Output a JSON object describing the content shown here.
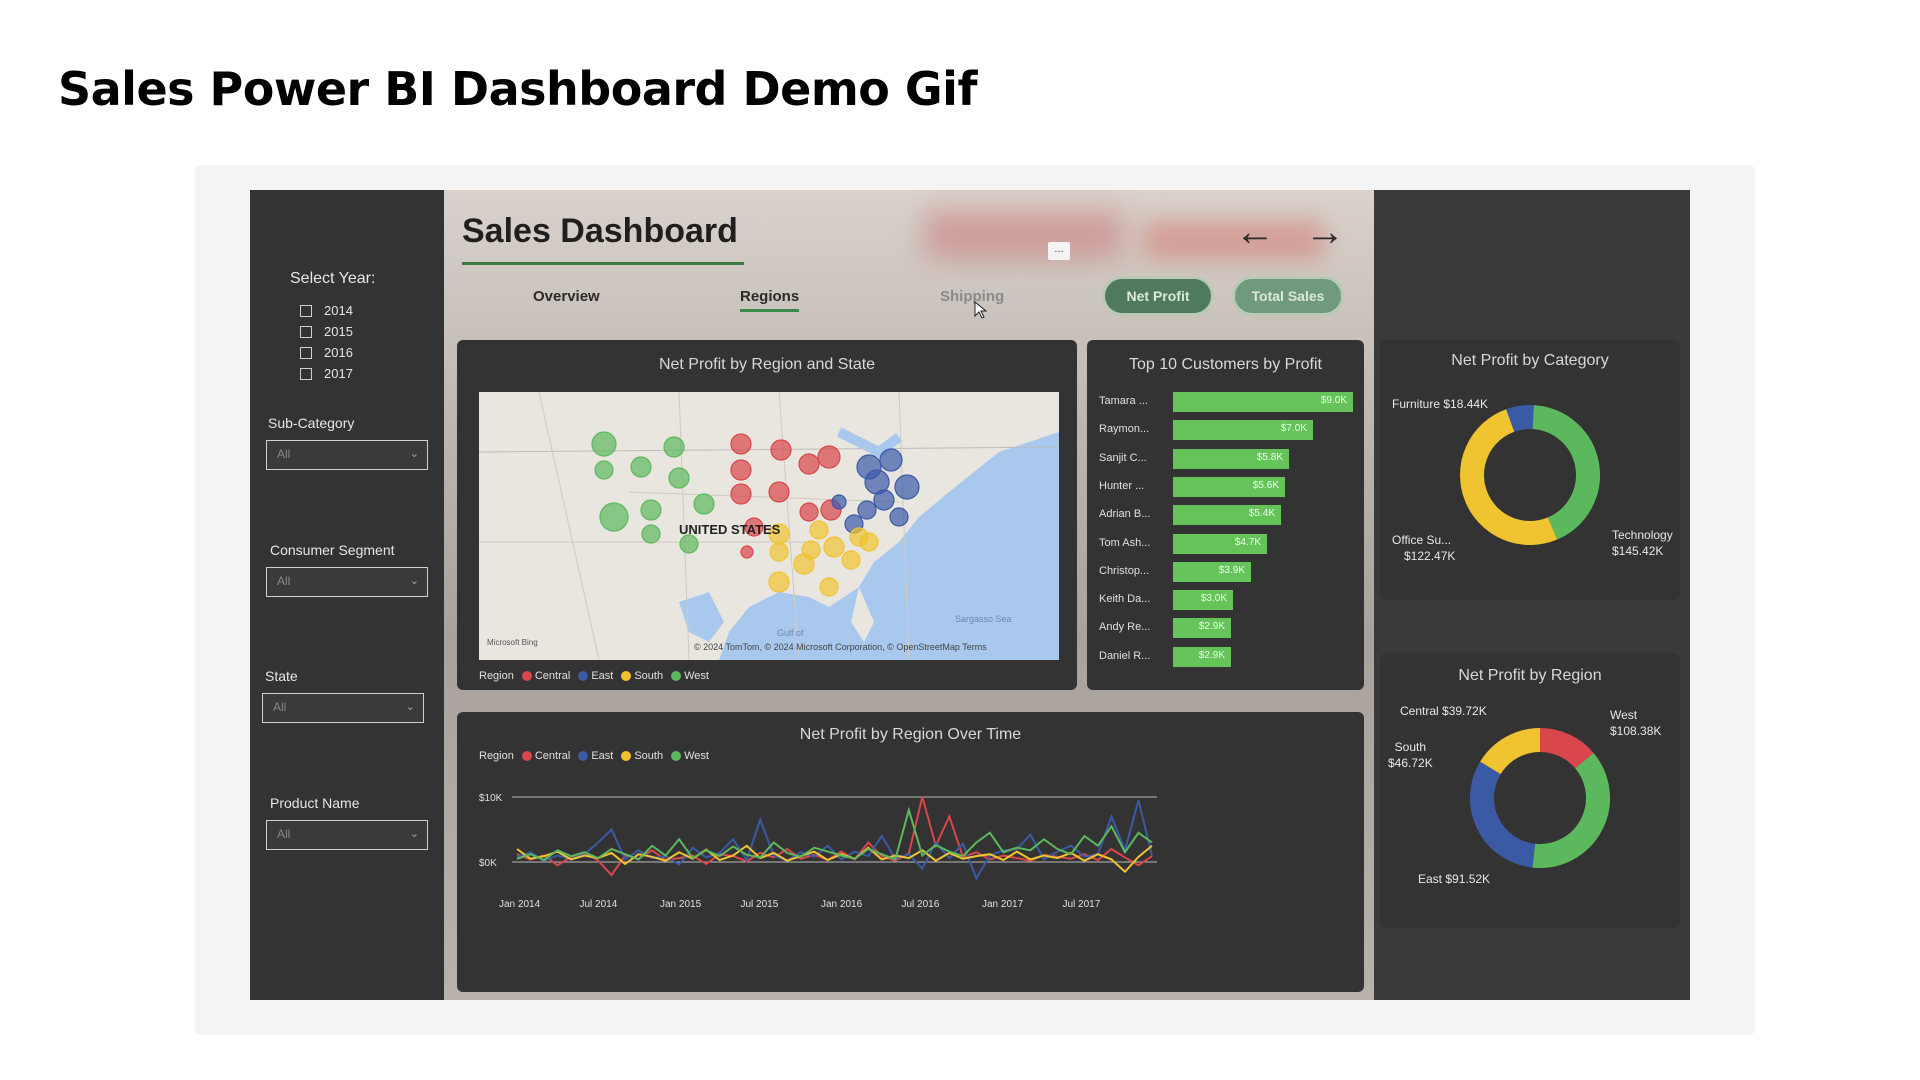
{
  "page_title": "Sales Power BI Dashboard Demo Gif",
  "dashboard": {
    "title": "Sales Dashboard",
    "tabs": [
      "Overview",
      "Regions",
      "Shipping"
    ],
    "buttons": {
      "net_profit": "Net Profit",
      "total_sales": "Total Sales"
    },
    "more_options": "..."
  },
  "sidebar": {
    "select_year_label": "Select Year:",
    "years": [
      "2014",
      "2015",
      "2016",
      "2017"
    ],
    "filters": [
      {
        "label": "Sub-Category",
        "value": "All"
      },
      {
        "label": "Consumer Segment",
        "value": "All"
      },
      {
        "label": "State",
        "value": "All"
      },
      {
        "label": "Product Name",
        "value": "All"
      }
    ]
  },
  "map_card": {
    "title": "Net Profit by Region and State",
    "country_label": "UNITED STATES",
    "attribution": "© 2024 TomTom, © 2024 Microsoft Corporation, © OpenStreetMap  Terms",
    "bing": "Microsoft Bing",
    "gulf": "Gulf of",
    "sea": "Sargasso Sea",
    "legend_title": "Region",
    "legend": [
      {
        "name": "Central",
        "color": "#d9464b"
      },
      {
        "name": "East",
        "color": "#3b5aa6"
      },
      {
        "name": "South",
        "color": "#f0c330"
      },
      {
        "name": "West",
        "color": "#5cb85c"
      }
    ]
  },
  "top_customers": {
    "title": "Top 10 Customers by Profit",
    "rows": [
      {
        "name": "Tamara ...",
        "value": 9.0,
        "label": "$9.0K"
      },
      {
        "name": "Raymon...",
        "value": 7.0,
        "label": "$7.0K"
      },
      {
        "name": "Sanjit C...",
        "value": 5.8,
        "label": "$5.8K"
      },
      {
        "name": "Hunter ...",
        "value": 5.6,
        "label": "$5.6K"
      },
      {
        "name": "Adrian B...",
        "value": 5.4,
        "label": "$5.4K"
      },
      {
        "name": "Tom Ash...",
        "value": 4.7,
        "label": "$4.7K"
      },
      {
        "name": "Christop...",
        "value": 3.9,
        "label": "$3.9K"
      },
      {
        "name": "Keith Da...",
        "value": 3.0,
        "label": "$3.0K"
      },
      {
        "name": "Andy Re...",
        "value": 2.9,
        "label": "$2.9K"
      },
      {
        "name": "Daniel R...",
        "value": 2.9,
        "label": "$2.9K"
      }
    ]
  },
  "line_card": {
    "title": "Net Profit by Region Over Time",
    "legend_title": "Region",
    "y_ticks": [
      "$10K",
      "$0K"
    ],
    "x_ticks": [
      "Jan 2014",
      "Jul 2014",
      "Jan 2015",
      "Jul 2015",
      "Jan 2016",
      "Jul 2016",
      "Jan 2017",
      "Jul 2017"
    ]
  },
  "category_donut": {
    "title": "Net Profit by Category",
    "labels": {
      "furniture": "Furniture $18.44K",
      "office": [
        "Office Su...",
        "$122.47K"
      ],
      "technology": [
        "Technology",
        "$145.42K"
      ]
    }
  },
  "region_donut": {
    "title": "Net Profit by Region",
    "labels": {
      "central": "Central $39.72K",
      "west": [
        "West",
        "$108.38K"
      ],
      "south": [
        "South",
        "$46.72K"
      ],
      "east": "East $91.52K"
    }
  },
  "chart_data": [
    {
      "type": "bar",
      "title": "Top 10 Customers by Profit",
      "categories": [
        "Tamara ...",
        "Raymon...",
        "Sanjit C...",
        "Hunter ...",
        "Adrian B...",
        "Tom Ash...",
        "Christop...",
        "Keith Da...",
        "Andy Re...",
        "Daniel R..."
      ],
      "values": [
        9.0,
        7.0,
        5.8,
        5.6,
        5.4,
        4.7,
        3.9,
        3.0,
        2.9,
        2.9
      ],
      "unit": "K"
    },
    {
      "type": "pie",
      "title": "Net Profit by Category",
      "categories": [
        "Furniture",
        "Office Su...",
        "Technology"
      ],
      "values": [
        18.44,
        122.47,
        145.42
      ],
      "colors": [
        "#3b5aa6",
        "#5cb85c",
        "#f0c330"
      ]
    },
    {
      "type": "pie",
      "title": "Net Profit by Region",
      "categories": [
        "Central",
        "West",
        "East",
        "South"
      ],
      "values": [
        39.72,
        108.38,
        91.52,
        46.72
      ],
      "colors": [
        "#d9464b",
        "#5cb85c",
        "#3b5aa6",
        "#f0c330"
      ]
    },
    {
      "type": "line",
      "title": "Net Profit by Region Over Time",
      "x": [
        "Jan 2014",
        "Jul 2014",
        "Jan 2015",
        "Jul 2015",
        "Jan 2016",
        "Jul 2016",
        "Jan 2017",
        "Jul 2017"
      ],
      "ylim": [
        -1,
        11
      ],
      "series": [
        {
          "name": "Central",
          "color": "#d9464b",
          "values": [
            1.2,
            0.4,
            1.0,
            -0.5,
            0.8,
            1.5,
            0.2,
            -2.0,
            1.0,
            0.5,
            1.8,
            0.3,
            0.6,
            1.0,
            -0.3,
            1.2,
            0.9,
            0.1,
            1.4,
            0.7,
            2.0,
            0.5,
            1.1,
            0.3,
            1.6,
            0.4,
            3.0,
            0.9,
            0.2,
            1.3,
            10.0,
            2.5,
            7.0,
            0.8,
            1.5,
            0.4,
            1.0,
            0.6,
            0.2,
            1.1,
            0.8,
            0.5,
            1.2,
            0.3,
            2.0,
            0.7,
            -0.5,
            0.9
          ]
        },
        {
          "name": "East",
          "color": "#3b5aa6",
          "values": [
            0.8,
            1.5,
            0.2,
            1.0,
            0.5,
            1.2,
            3.0,
            5.0,
            0.4,
            1.8,
            0.6,
            0.9,
            -0.4,
            2.2,
            0.7,
            1.4,
            3.5,
            0.3,
            6.5,
            1.0,
            0.2,
            1.5,
            0.8,
            2.5,
            0.4,
            1.6,
            0.9,
            4.0,
            0.5,
            1.2,
            -1.0,
            3.0,
            0.6,
            2.8,
            -2.5,
            1.0,
            1.8,
            2.0,
            4.2,
            0.4,
            1.6,
            2.5,
            0.8,
            1.2,
            7.0,
            1.8,
            9.5,
            1.0
          ]
        },
        {
          "name": "South",
          "color": "#f0c330",
          "values": [
            2.0,
            0.5,
            0.9,
            1.6,
            0.4,
            1.0,
            0.6,
            1.4,
            -0.3,
            1.2,
            0.8,
            0.2,
            1.5,
            0.5,
            1.9,
            0.3,
            1.0,
            2.5,
            0.6,
            1.4,
            0.2,
            0.9,
            1.6,
            0.3,
            1.2,
            0.5,
            2.2,
            0.4,
            1.0,
            0.6,
            1.8,
            0.2,
            1.4,
            0.5,
            0.9,
            1.2,
            0.3,
            1.6,
            0.4,
            1.0,
            0.6,
            1.4,
            0.2,
            1.2,
            0.4,
            -1.5,
            0.8,
            2.5
          ]
        },
        {
          "name": "West",
          "color": "#5cb85c",
          "values": [
            0.5,
            1.2,
            0.3,
            1.8,
            0.9,
            1.5,
            0.6,
            2.0,
            1.2,
            0.4,
            2.5,
            1.0,
            3.5,
            0.6,
            1.8,
            0.9,
            2.4,
            1.1,
            0.7,
            3.0,
            1.4,
            0.8,
            2.2,
            1.6,
            1.0,
            0.5,
            2.0,
            1.2,
            0.4,
            8.0,
            1.0,
            2.6,
            1.6,
            0.9,
            3.0,
            4.5,
            1.5,
            2.2,
            1.8,
            3.5,
            2.0,
            1.2,
            4.0,
            2.5,
            5.5,
            1.5,
            4.5,
            3.0
          ]
        }
      ]
    }
  ]
}
